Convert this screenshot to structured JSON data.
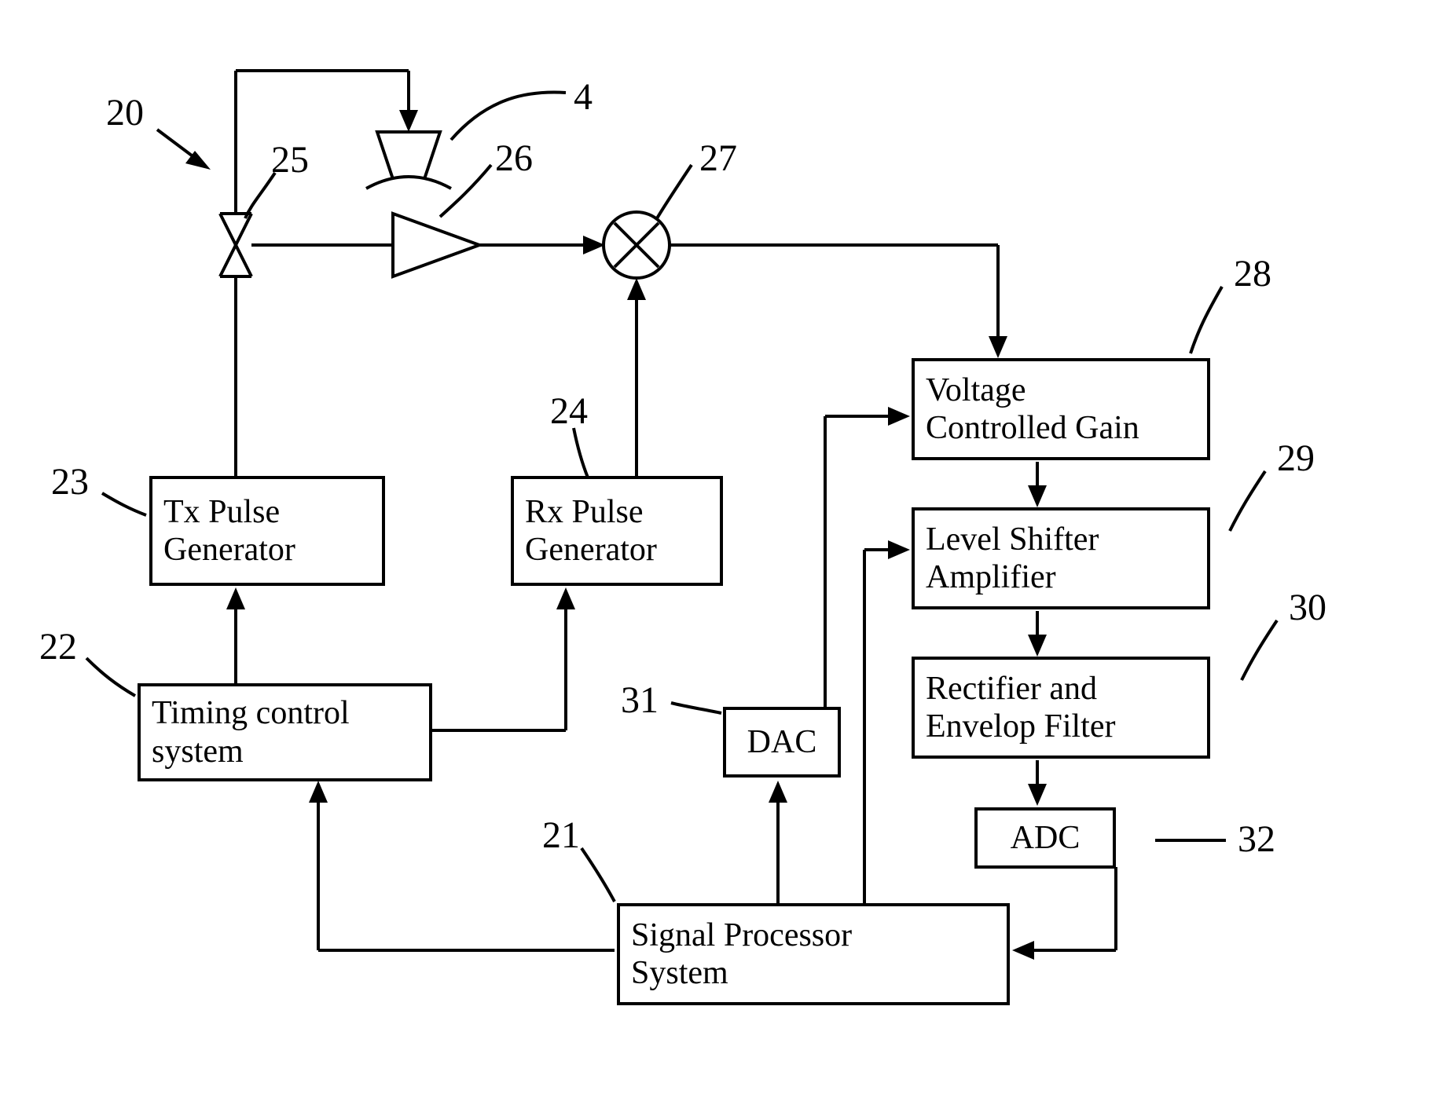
{
  "blocks": {
    "tx_pulse": "Tx Pulse\nGenerator",
    "rx_pulse": "Rx Pulse\nGenerator",
    "timing": "Timing control\nsystem",
    "vcg": "Voltage\nControlled Gain",
    "lsa": "Level Shifter\nAmplifier",
    "rect": "Rectifier and\nEnvelop Filter",
    "dac": "DAC",
    "adc": "ADC",
    "sps": "Signal Processor\nSystem"
  },
  "labels": {
    "l20": "20",
    "l25": "25",
    "l4": "4",
    "l26": "26",
    "l27": "27",
    "l28": "28",
    "l29": "29",
    "l30": "30",
    "l23": "23",
    "l22": "22",
    "l24": "24",
    "l31": "31",
    "l21": "21",
    "l32": "32"
  }
}
